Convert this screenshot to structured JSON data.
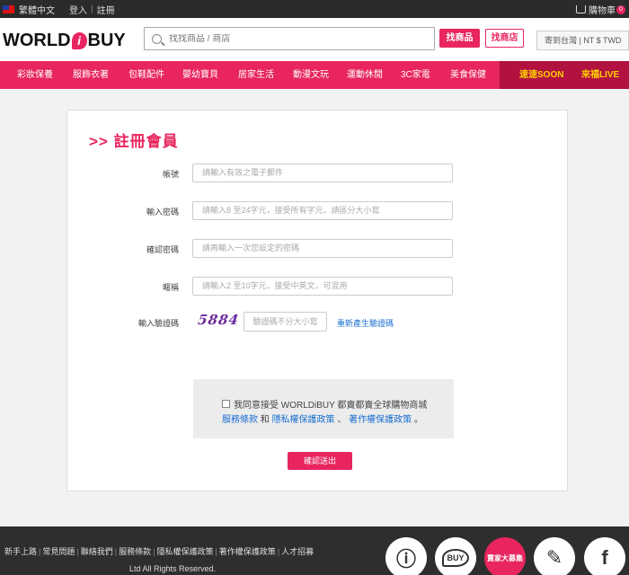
{
  "topbar": {
    "language": "繁體中文",
    "login": "登入",
    "separator": "|",
    "register": "註冊",
    "cart_label": "購物車",
    "cart_count": "0"
  },
  "header": {
    "logo_part1": "WORLD",
    "logo_i": "i",
    "logo_part2": "BUY",
    "search_placeholder": "找找商品 / 商店",
    "search_product_button": "找商品",
    "search_store_button": "找商店",
    "region_select": "寄到台灣 | NT $ TWD"
  },
  "nav": {
    "items": [
      "彩妝保養",
      "服飾衣著",
      "包鞋配件",
      "嬰幼寶貝",
      "居家生活",
      "動漫文玩",
      "運動休閒",
      "3C家電",
      "美食保健"
    ],
    "promo1": "速速SOON",
    "promo2": "來福LIVE"
  },
  "form": {
    "title": ">> 註冊會員",
    "account_label": "帳號",
    "account_placeholder": "請輸入有效之電子郵件",
    "password_label": "輸入密碼",
    "password_placeholder": "請輸入8 至24字元，接受所有字元，請區分大小寫",
    "confirm_label": "確認密碼",
    "confirm_placeholder": "請再輸入一次您設定的密碼",
    "nickname_label": "暱稱",
    "nickname_placeholder": "請輸入2 至10字元，接受中英文，可混用",
    "captcha_label": "輸入驗證碼",
    "captcha_text": "5884",
    "captcha_placeholder": "驗證碼不分大小寫",
    "captcha_refresh": "重新產生驗證碼",
    "agree_text": "我同意接受 WORLDiBUY 都賣都賣全球購物商城",
    "terms_link": "服務條款",
    "and_text": "和",
    "privacy_link": "隱私權保護政策",
    "comma": "、",
    "copyright_link": "著作權保護政策",
    "period": "。",
    "submit_button": "確認送出"
  },
  "footer": {
    "links": [
      "新手上路",
      "常見問題",
      "聯絡我們",
      "服務條款",
      "隱私權保護政策",
      "著作權保護政策",
      "人才招募"
    ],
    "separator": "|",
    "copyright": "Ltd All Rights Reserved.",
    "fab_buy": "BUY",
    "fab_seller": "賣家大募集"
  },
  "colors": {
    "brand": "#e8255e",
    "nav_dark": "#b1123f",
    "promo": "#ffd200",
    "link": "#1a6fd1"
  }
}
